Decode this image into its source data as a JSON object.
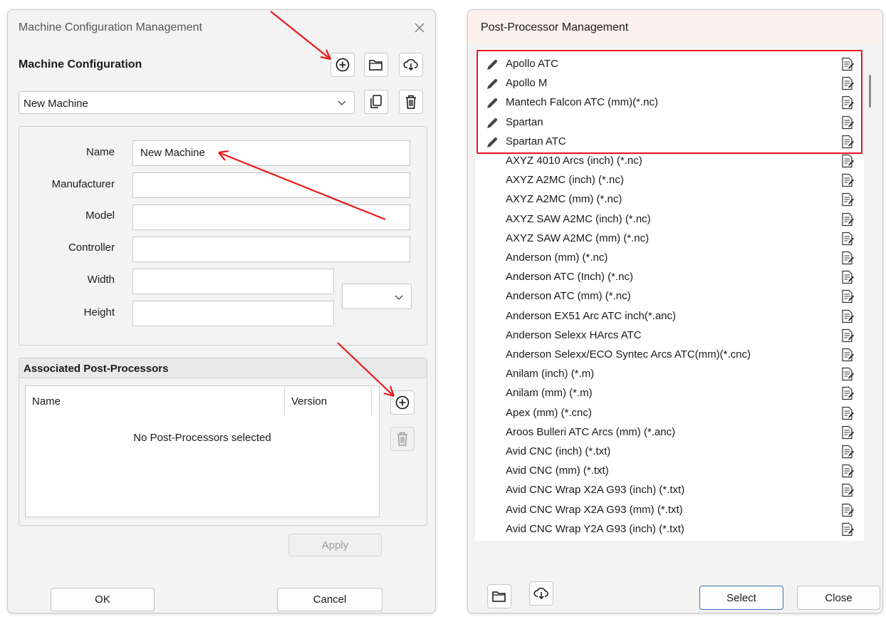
{
  "machine_dialog": {
    "title": "Machine Configuration Management",
    "section_title": "Machine Configuration",
    "machine_select": {
      "value": "New Machine"
    },
    "form": {
      "name_label": "Name",
      "name_value": "New Machine",
      "manufacturer_label": "Manufacturer",
      "manufacturer_value": "",
      "model_label": "Model",
      "model_value": "",
      "controller_label": "Controller",
      "controller_value": "",
      "width_label": "Width",
      "width_value": "",
      "height_label": "Height",
      "height_value": "",
      "units_value": ""
    },
    "associated": {
      "title": "Associated Post-Processors",
      "columns": [
        "Name",
        "Version"
      ],
      "empty_text": "No Post-Processors selected"
    },
    "apply_label": "Apply",
    "ok_label": "OK",
    "cancel_label": "Cancel"
  },
  "pp_dialog": {
    "title": "Post-Processor Management",
    "items": [
      {
        "name": "Apollo ATC",
        "custom": true
      },
      {
        "name": "Apollo M",
        "custom": true
      },
      {
        "name": "Mantech Falcon ATC (mm)(*.nc)",
        "custom": true
      },
      {
        "name": "Spartan",
        "custom": true
      },
      {
        "name": "Spartan ATC",
        "custom": true
      },
      {
        "name": "AXYZ 4010 Arcs (inch) (*.nc)",
        "custom": false
      },
      {
        "name": "AXYZ A2MC (inch) (*.nc)",
        "custom": false
      },
      {
        "name": "AXYZ A2MC (mm) (*.nc)",
        "custom": false
      },
      {
        "name": "AXYZ SAW A2MC (inch) (*.nc)",
        "custom": false
      },
      {
        "name": "AXYZ SAW A2MC (mm) (*.nc)",
        "custom": false
      },
      {
        "name": "Anderson (mm) (*.nc)",
        "custom": false
      },
      {
        "name": "Anderson ATC (Inch) (*.nc)",
        "custom": false
      },
      {
        "name": "Anderson ATC (mm) (*.nc)",
        "custom": false
      },
      {
        "name": "Anderson EX51 Arc ATC inch(*.anc)",
        "custom": false
      },
      {
        "name": "Anderson Selexx HArcs ATC",
        "custom": false
      },
      {
        "name": "Anderson Selexx/ECO Syntec Arcs ATC(mm)(*.cnc)",
        "custom": false
      },
      {
        "name": "Anilam (inch) (*.m)",
        "custom": false
      },
      {
        "name": "Anilam (mm) (*.m)",
        "custom": false
      },
      {
        "name": "Apex (mm) (*.cnc)",
        "custom": false
      },
      {
        "name": "Aroos Bulleri ATC Arcs (mm) (*.anc)",
        "custom": false
      },
      {
        "name": "Avid CNC (inch) (*.txt)",
        "custom": false
      },
      {
        "name": "Avid CNC (mm) (*.txt)",
        "custom": false
      },
      {
        "name": "Avid CNC Wrap X2A G93 (inch) (*.txt)",
        "custom": false
      },
      {
        "name": "Avid CNC Wrap X2A G93 (mm) (*.txt)",
        "custom": false
      },
      {
        "name": "Avid CNC Wrap Y2A G93 (inch) (*.txt)",
        "custom": false
      }
    ],
    "select_label": "Select",
    "close_label": "Close"
  },
  "annotation_color": "#e8191b",
  "highlight_color": "#e0141e"
}
